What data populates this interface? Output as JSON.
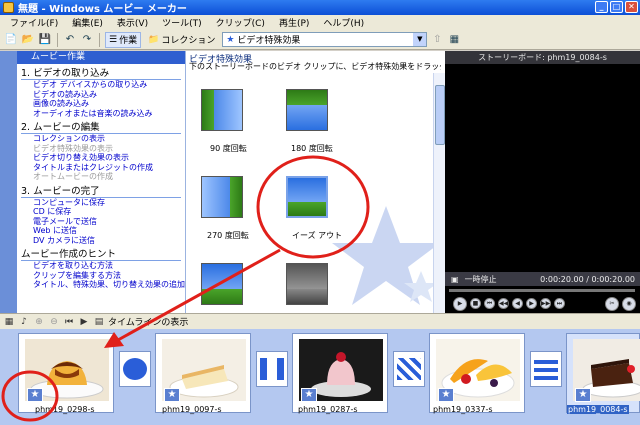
{
  "window": {
    "title": "無題 - Windows ムービー メーカー"
  },
  "menu": [
    "ファイル(F)",
    "編集(E)",
    "表示(V)",
    "ツール(T)",
    "クリップ(C)",
    "再生(P)",
    "ヘルプ(H)"
  ],
  "toolbar": {
    "tasks_label": "作業",
    "collections_label": "コレクション",
    "collection_selected": "ビデオ特殊効果"
  },
  "task_pane": {
    "header": "ムービー作業",
    "sections": [
      {
        "title": "1. ビデオの取り込み",
        "links": [
          {
            "text": "ビデオ デバイスからの取り込み",
            "enabled": true
          },
          {
            "text": "ビデオの読み込み",
            "enabled": true
          },
          {
            "text": "画像の読み込み",
            "enabled": true
          },
          {
            "text": "オーディオまたは音楽の読み込み",
            "enabled": true
          }
        ]
      },
      {
        "title": "2. ムービーの編集",
        "links": [
          {
            "text": "コレクションの表示",
            "enabled": true
          },
          {
            "text": "ビデオ特殊効果の表示",
            "enabled": false
          },
          {
            "text": "ビデオ切り替え効果の表示",
            "enabled": true
          },
          {
            "text": "タイトルまたはクレジットの作成",
            "enabled": true
          },
          {
            "text": "オートムービーの作成",
            "enabled": false
          }
        ]
      },
      {
        "title": "3. ムービーの完了",
        "links": [
          {
            "text": "コンピュータに保存",
            "enabled": true
          },
          {
            "text": "CD に保存",
            "enabled": true
          },
          {
            "text": "電子メールで送信",
            "enabled": true
          },
          {
            "text": "Web に送信",
            "enabled": true
          },
          {
            "text": "DV カメラに送信",
            "enabled": true
          }
        ]
      },
      {
        "title": "ムービー作成のヒント",
        "links": [
          {
            "text": "ビデオを取り込む方法",
            "enabled": true
          },
          {
            "text": "クリップを編集する方法",
            "enabled": true
          },
          {
            "text": "タイトル、特殊効果、切り替え効果の追加",
            "enabled": true
          }
        ]
      }
    ]
  },
  "effects_panel": {
    "title": "ビデオ特殊効果",
    "description": "下のストーリーボードのビデオ クリップに、ビデオ特殊効果をドラッグ アンド ドロップしてください。",
    "items": [
      {
        "label": "90 度回転"
      },
      {
        "label": "180 度回転"
      },
      {
        "label": "270 度回転"
      },
      {
        "label": "イーズ アウト"
      },
      {
        "label": ""
      },
      {
        "label": ""
      }
    ]
  },
  "preview": {
    "title": "ストーリーボード: phm19_0084-s",
    "status": "一時停止",
    "time": "0:00:20.00 / 0:00:20.00"
  },
  "storyboard_toolbar": {
    "timeline_label": "タイムラインの表示"
  },
  "clips": [
    {
      "name": "phm19_0298-s",
      "selected": false
    },
    {
      "name": "phm19_0097-s",
      "selected": false
    },
    {
      "name": "phm19_0287-s",
      "selected": false
    },
    {
      "name": "phm19_0337-s",
      "selected": false
    },
    {
      "name": "phm19_0084-s",
      "selected": true
    }
  ],
  "colors": {
    "annotation_red": "#e0201a",
    "title_blue": "#0c4fd6",
    "storyboard_bg": "#b4c8f0"
  }
}
